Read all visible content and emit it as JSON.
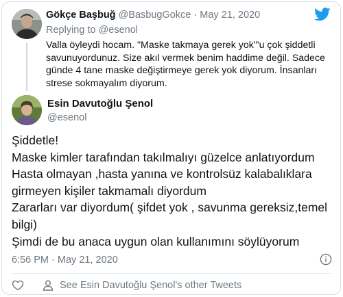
{
  "reply": {
    "name": "Gökçe Başbuğ",
    "handle": "@BasbugGokce",
    "separator": "·",
    "date": "May 21, 2020",
    "replying_to_label": "Replying to",
    "replying_to_handle": "@esenol",
    "text": "Valla öyleydi hocam. \"Maske takmaya gerek yok\"'u çok şiddetli savunuyordunuz. Size akıl vermek benim haddime değil. Sadece günde 4 tane maske değiştirmeye gerek yok diyorum. İnsanları strese sokmayalım diyorum."
  },
  "tweet": {
    "name": "Esin Davutoğlu Şenol",
    "handle": "@esenol",
    "lines": [
      "Şiddetle!",
      "Maske kimler tarafından takılmalıyı güzelce anlatıyordum",
      "Hasta olmayan ,hasta yanına ve kontrolsüz kalabalıklara",
      "girmeyen kişiler takmamalı diyordum",
      "Zararları var diyordum( şifdet yok , savunma gereksiz,temel",
      "bilgi)",
      "Şimdi de bu anaca uygun olan kullanımını söylüyorum"
    ],
    "time": "6:56 PM",
    "separator": "·",
    "date": "May 21, 2020"
  },
  "actions": {
    "other_tweets_label": "See Esin Davutoğlu Şenol's other Tweets"
  },
  "icons": {
    "logo": "twitter-bird-icon",
    "info": "info-icon",
    "like": "heart-icon",
    "profile": "person-icon"
  },
  "colors": {
    "brand": "#1d9bf0",
    "muted_text": "#6e7881",
    "text": "#0f1419",
    "border": "#d8dde2"
  }
}
